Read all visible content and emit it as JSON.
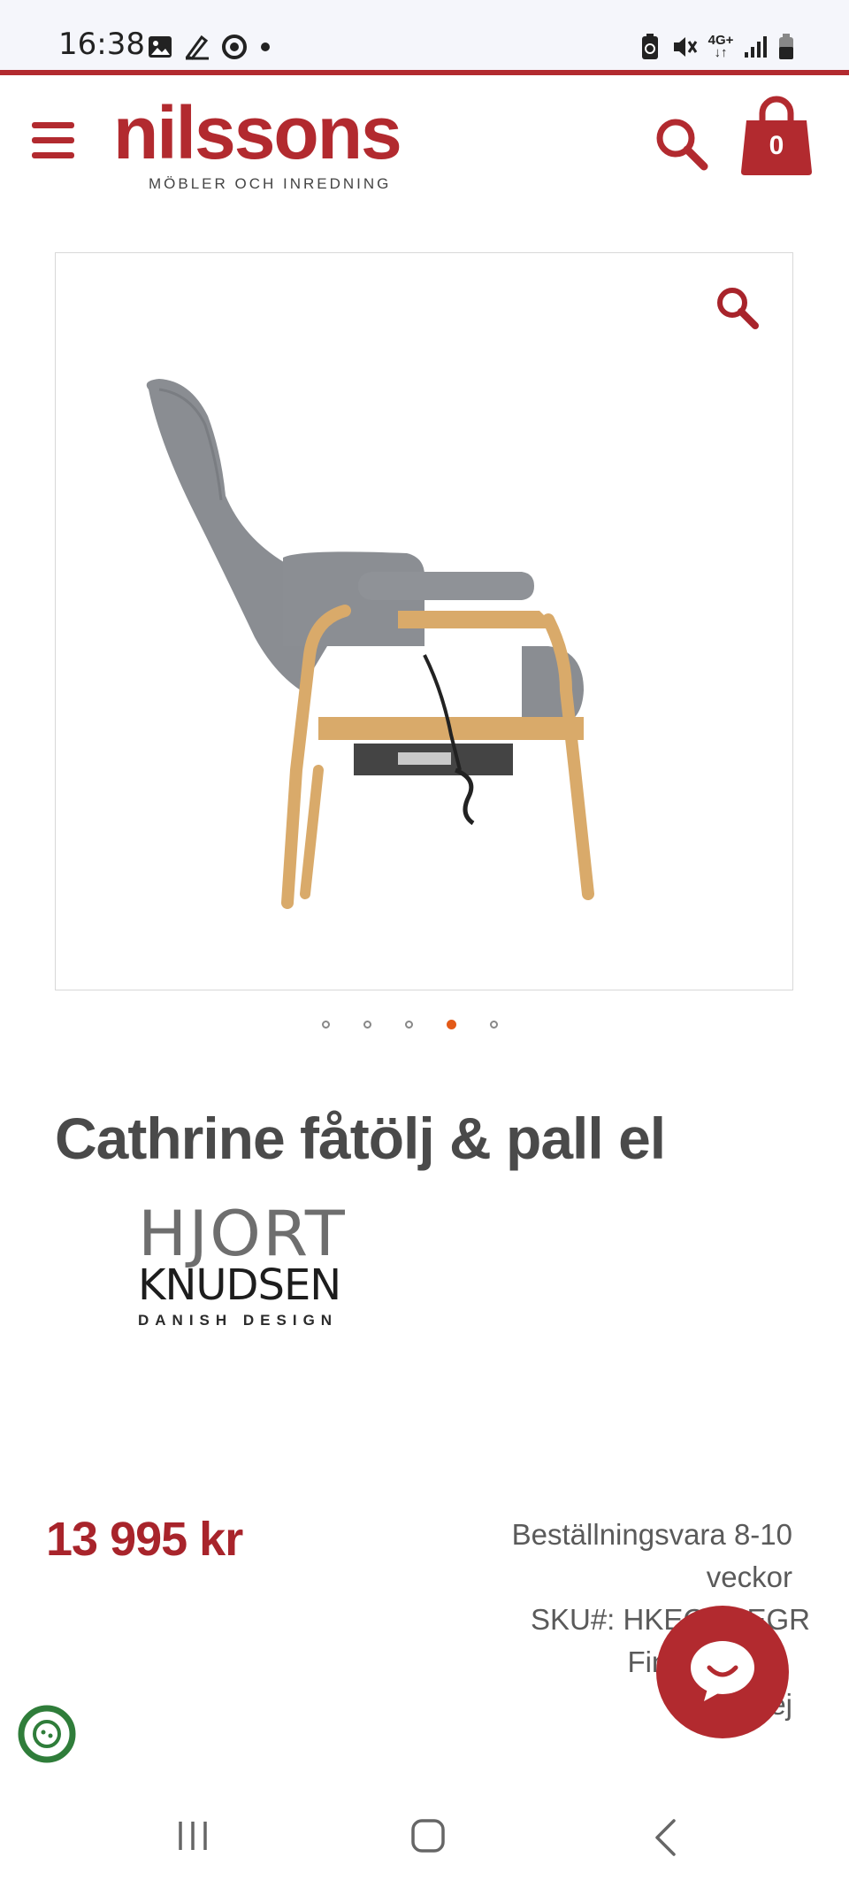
{
  "status_bar": {
    "time": "16:38",
    "left_icons": [
      "gallery-icon",
      "pen-icon",
      "chrome-icon",
      "dot-icon"
    ],
    "right_icons": [
      "battery-saver-icon",
      "mute-icon",
      "network-4g-icon",
      "signal-icon",
      "battery-icon"
    ],
    "network_label": "4G+"
  },
  "header": {
    "logo_text": "nilssons",
    "logo_tagline": "MÖBLER OCH INREDNING",
    "cart_count": "0",
    "brand_color": "#b22a2f"
  },
  "gallery": {
    "total_images": 5,
    "active_index": 3
  },
  "product": {
    "title": "Cathrine fåtölj & pall el",
    "brand": {
      "top": "HJORT",
      "middle": "KNUDSEN",
      "bottom": "DANISH DESIGN"
    },
    "price": "13 995 kr",
    "availability_line1": "Beställningsvara 8-10",
    "availability_line2": "veckor",
    "sku": "SKU#:  HKECAT    EGR",
    "stock_line": "Finns att",
    "stock_line_end": "ej"
  },
  "colors": {
    "accent": "#b22a2f",
    "price": "#a8242b",
    "active_dot": "#e35a18"
  }
}
